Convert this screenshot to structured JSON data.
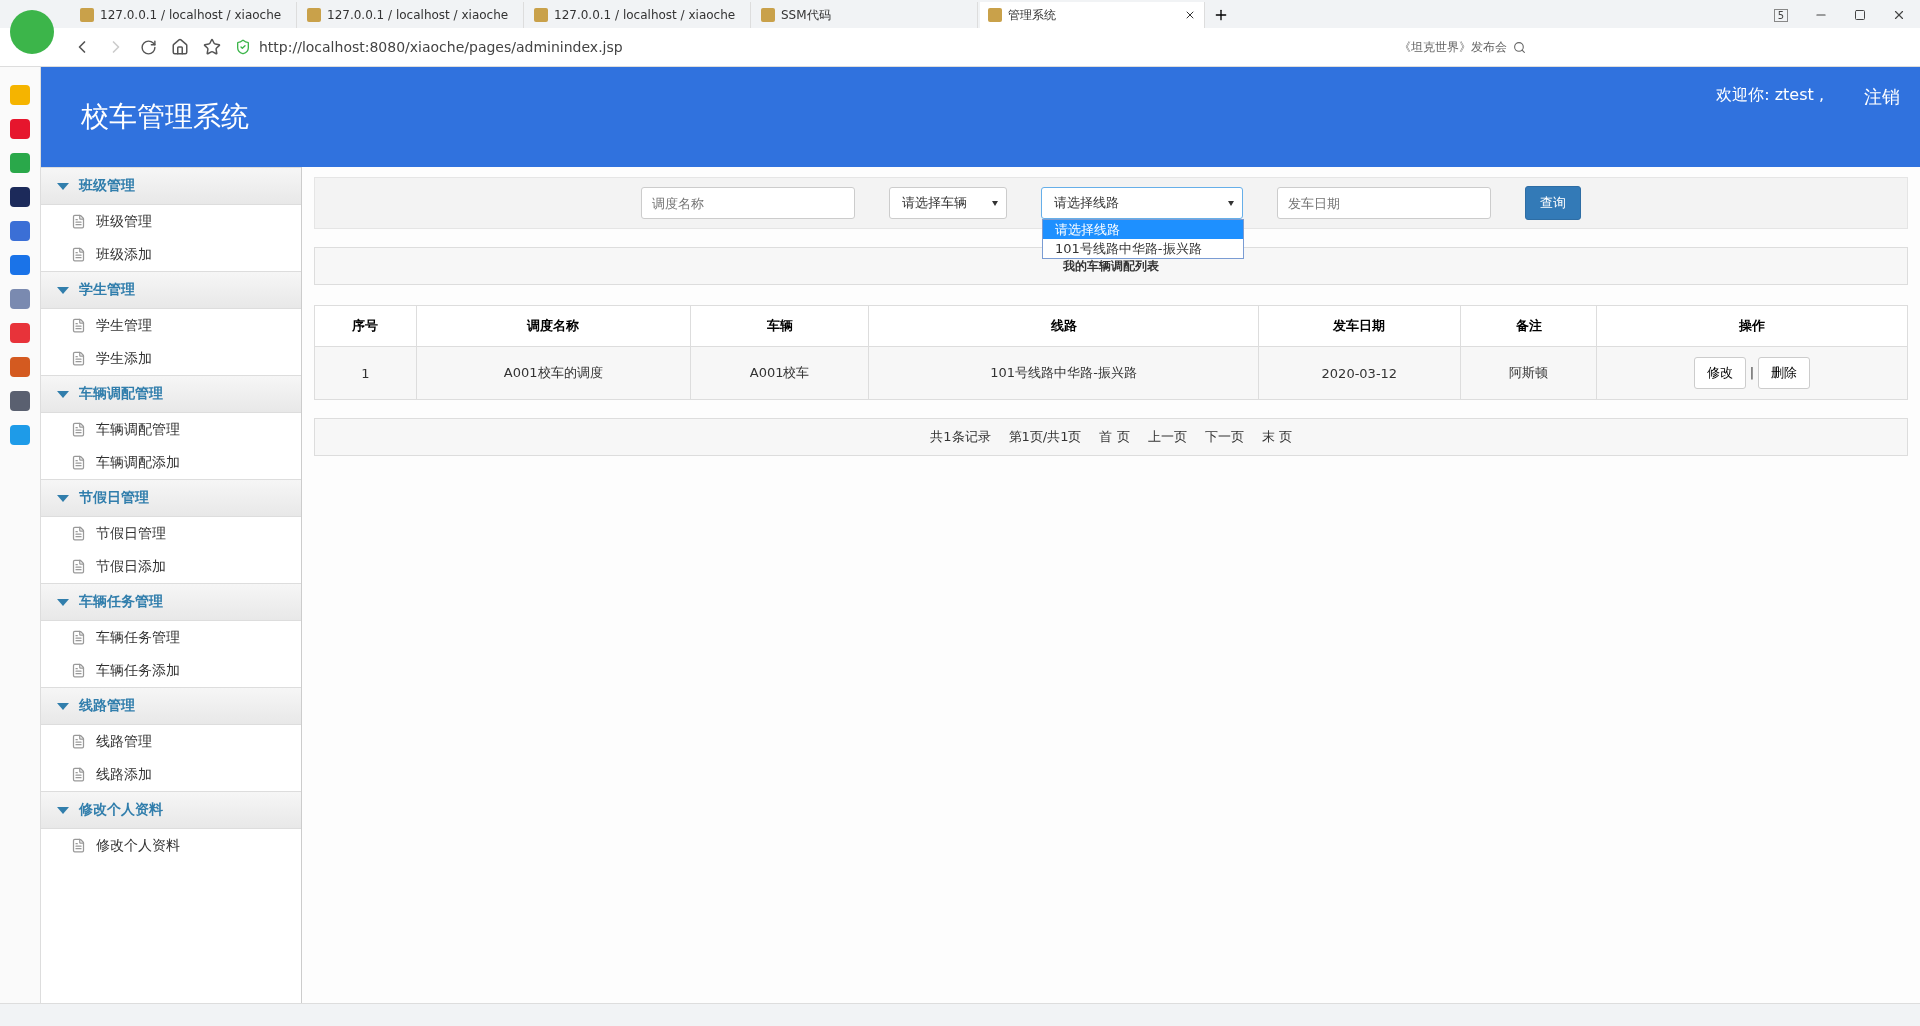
{
  "browser": {
    "tabs": [
      {
        "label": "127.0.0.1 / localhost / xiaoche",
        "selected": false
      },
      {
        "label": "127.0.0.1 / localhost / xiaoche",
        "selected": false
      },
      {
        "label": "127.0.0.1 / localhost / xiaoche",
        "selected": false
      },
      {
        "label": "SSM代码",
        "selected": false
      },
      {
        "label": "管理系统",
        "selected": true
      }
    ],
    "tab_count": "5",
    "address": "http://localhost:8080/xiaoche/pages/adminindex.jsp",
    "search_hint": "《坦克世界》发布会"
  },
  "header": {
    "title": "校车管理系统",
    "welcome": "欢迎你: ztest ,",
    "logout": "注销"
  },
  "sidebar": {
    "groups": [
      {
        "label": "班级管理",
        "expanded": true,
        "children": [
          {
            "label": "班级管理"
          },
          {
            "label": "班级添加"
          }
        ]
      },
      {
        "label": "学生管理",
        "expanded": true,
        "children": [
          {
            "label": "学生管理"
          },
          {
            "label": "学生添加"
          }
        ]
      },
      {
        "label": "车辆调配管理",
        "expanded": true,
        "children": [
          {
            "label": "车辆调配管理"
          },
          {
            "label": "车辆调配添加"
          }
        ]
      },
      {
        "label": "节假日管理",
        "expanded": true,
        "children": [
          {
            "label": "节假日管理"
          },
          {
            "label": "节假日添加"
          }
        ]
      },
      {
        "label": "车辆任务管理",
        "expanded": true,
        "children": [
          {
            "label": "车辆任务管理"
          },
          {
            "label": "车辆任务添加"
          }
        ]
      },
      {
        "label": "线路管理",
        "expanded": true,
        "children": [
          {
            "label": "线路管理"
          },
          {
            "label": "线路添加"
          }
        ]
      },
      {
        "label": "修改个人资料",
        "expanded": true,
        "children": [
          {
            "label": "修改个人资料"
          }
        ]
      }
    ]
  },
  "filter": {
    "name": {
      "placeholder": "调度名称"
    },
    "vehicle": {
      "value": "请选择车辆"
    },
    "route": {
      "value": "请选择线路",
      "expanded": true,
      "options": [
        {
          "label": "请选择线路",
          "selected": true
        },
        {
          "label": "101号线路中华路-振兴路",
          "selected": false
        }
      ]
    },
    "date": {
      "placeholder": "发车日期"
    },
    "search_button": "查询"
  },
  "table": {
    "title": "我的车辆调配列表",
    "columns": [
      "序号",
      "调度名称",
      "车辆",
      "线路",
      "发车日期",
      "备注",
      "操作"
    ],
    "rows": [
      {
        "cells": [
          "1",
          "A001校车的调度",
          "A001校车",
          "101号线路中华路-振兴路",
          "2020-03-12",
          "阿斯顿"
        ],
        "actions": [
          "修改",
          "删除"
        ],
        "separator": "|"
      }
    ]
  },
  "pagination": [
    "共1条记录",
    "第1页/共1页",
    "首 页",
    "上一页",
    "下一页",
    "末 页"
  ]
}
